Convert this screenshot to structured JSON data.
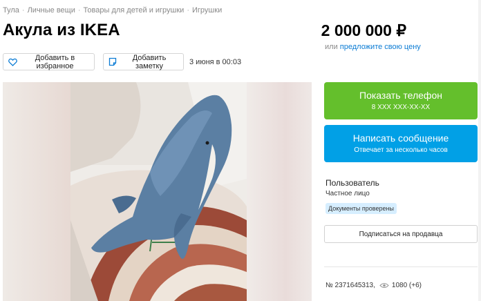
{
  "breadcrumb": [
    {
      "label": "Тула"
    },
    {
      "label": "Личные вещи"
    },
    {
      "label": "Товары для детей и игрушки"
    },
    {
      "label": "Игрушки"
    }
  ],
  "listing": {
    "title": "Акула из IKEA",
    "price": "2 000 000 ₽",
    "price_or": "или",
    "price_offer_link": "предложите свою цену",
    "date": "3 июня в 00:03",
    "number": "№ 2371645313,",
    "views": "1080 (+6)"
  },
  "actions": {
    "favorite_label": "Добавить в избранное",
    "note_label": "Добавить заметку"
  },
  "contact": {
    "phone_title": "Показать телефон",
    "phone_masked": "8 XXX XXX-XX-XX",
    "message_title": "Написать сообщение",
    "message_sub": "Отвечает за несколько часов"
  },
  "seller": {
    "name": "Пользователь",
    "type": "Частное лицо",
    "badge": "Документы проверены",
    "subscribe_label": "Подписаться на продавца"
  },
  "colors": {
    "green_cta": "#64bf2c",
    "blue_cta": "#01a0e6",
    "link": "#0a7bd4",
    "badge_bg": "#d6eeff"
  },
  "icons": {
    "favorite": "heart-icon",
    "note": "note-icon",
    "views": "eye-icon"
  }
}
